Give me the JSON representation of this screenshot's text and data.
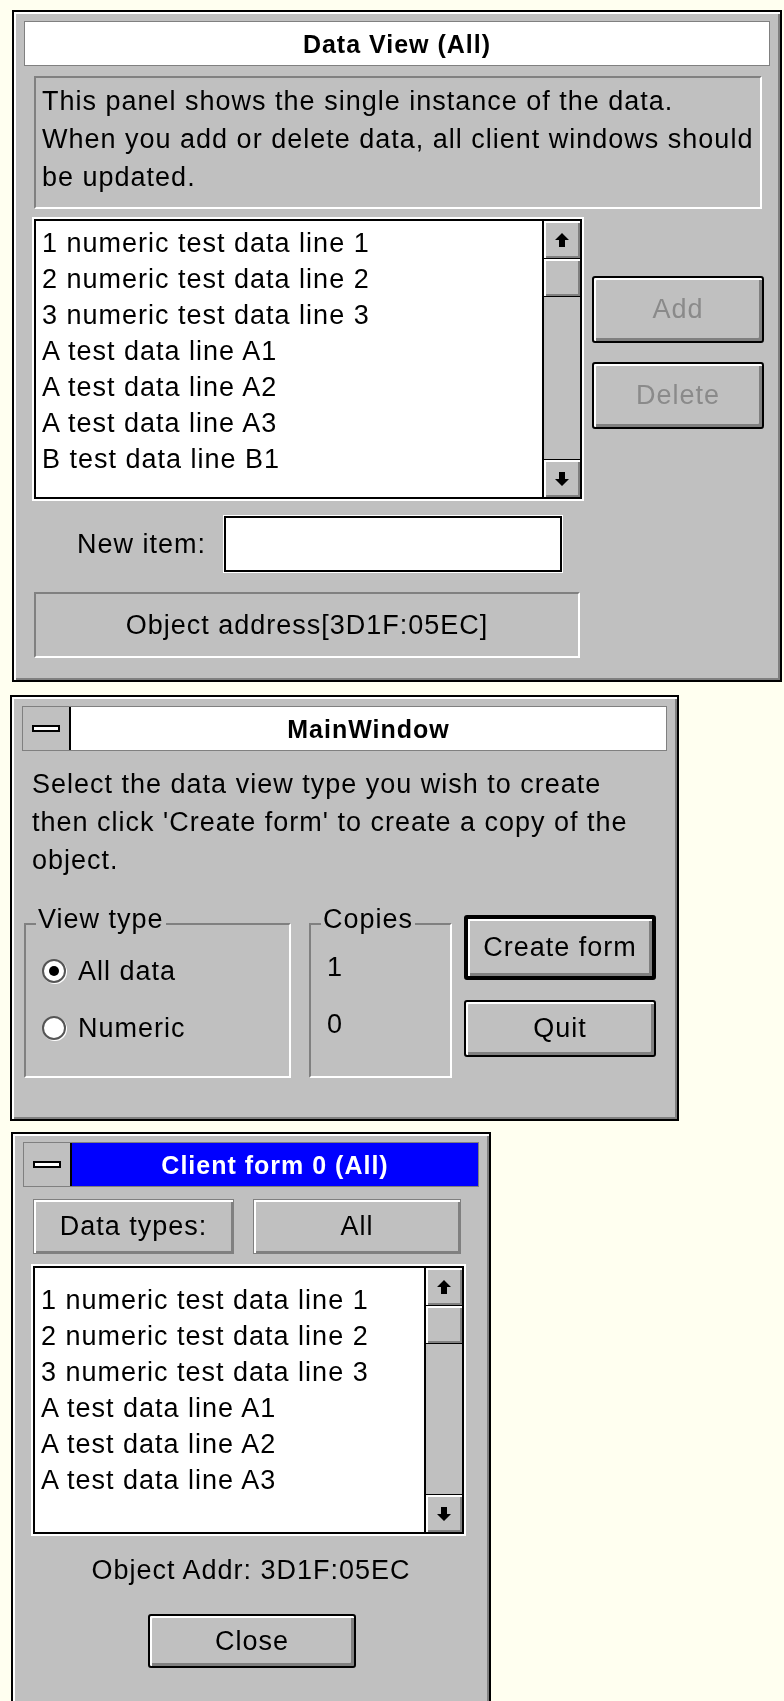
{
  "data_view": {
    "title": "Data View (All)",
    "active": false,
    "description": "This panel shows the single instance of the data. When you add or delete data, all client windows should be updated.",
    "list_items": [
      "1 numeric test data line 1",
      "2 numeric test data line 2",
      "3 numeric test data line 3",
      "A test data line A1",
      "A test data line A2",
      "A test data line A3",
      "B test data line B1"
    ],
    "buttons": [
      {
        "label": "Add",
        "disabled": true
      },
      {
        "label": "Delete",
        "disabled": true
      }
    ],
    "new_item": {
      "label": "New item:"
    },
    "address": "Object address[3D1F:05EC]"
  },
  "main_window": {
    "title": "MainWindow",
    "active": false,
    "description": "Select the data view type you wish to create then click 'Create form' to create a copy of the object.",
    "view_type": {
      "label": "View type",
      "options": [
        {
          "label": "All data",
          "selected": true
        },
        {
          "label": "Numeric",
          "selected": false
        }
      ]
    },
    "copies": {
      "label": "Copies",
      "values": [
        "1",
        "0"
      ]
    },
    "buttons": [
      {
        "label": "Create form",
        "default": true
      },
      {
        "label": "Quit",
        "default": false
      }
    ]
  },
  "client_form": {
    "title": "Client form 0 (All)",
    "active": true,
    "data_types_label": "Data types:",
    "data_types_value": "All",
    "list_items": [
      "1 numeric test data line 1",
      "2 numeric test data line 2",
      "3 numeric test data line 3",
      "A test data line A1",
      "A test data line A2",
      "A test data line A3"
    ],
    "address": "Object Addr: 3D1F:05EC",
    "close": "Close"
  }
}
